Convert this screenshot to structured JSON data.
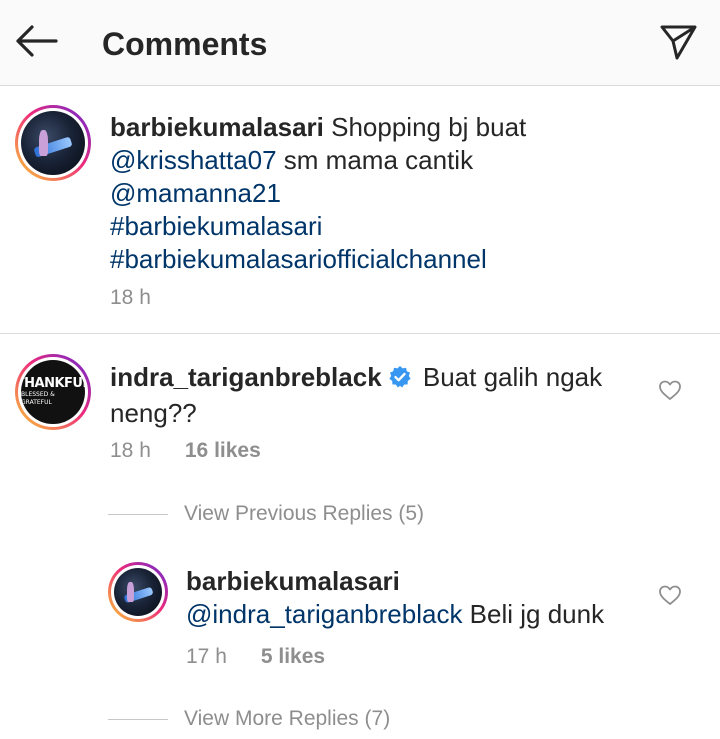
{
  "header": {
    "title": "Comments",
    "back_icon": "arrow-left-icon",
    "send_icon": "paper-plane-icon"
  },
  "caption": {
    "username": "barbiekumalasari",
    "text_1": " Shopping bj buat",
    "mention_1": "@krisshatta07",
    "text_2": " sm mama cantik",
    "mention_2": "@mamanna21",
    "hashtag_1": "#barbiekumalasari",
    "hashtag_2": "#barbiekumalasariofficialchannel",
    "time": "18 h"
  },
  "comment": {
    "username": "indra_tariganbreblack",
    "verified": true,
    "text_line1": " Buat galih ngak",
    "text_line2": "neng??",
    "time": "18 h",
    "likes": "16 likes",
    "avatar_text_1": "THANKFUL",
    "avatar_text_2": "BLESSED & GRATEFUL"
  },
  "view_previous": "View Previous Replies (5)",
  "reply": {
    "username": "barbiekumalasari",
    "mention": "@indra_tariganbreblack",
    "text": " Beli jg dunk",
    "time": "17 h",
    "likes": "5 likes"
  },
  "view_more": "View More Replies (7)",
  "colors": {
    "link": "#003569",
    "meta": "#8e8e8e",
    "verified": "#3897f0",
    "divider": "#dbdbdb"
  }
}
